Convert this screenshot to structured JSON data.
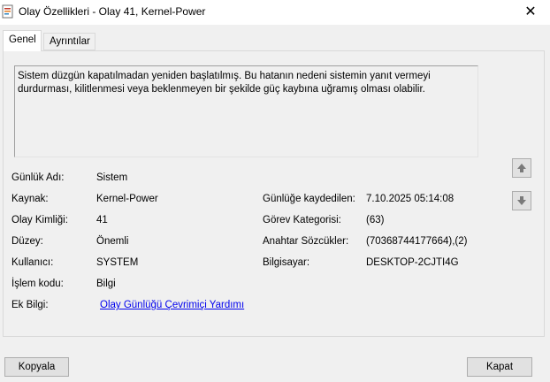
{
  "window": {
    "title": "Olay Özellikleri - Olay 41, Kernel-Power",
    "icon": "event-viewer-icon",
    "close_glyph": "✕"
  },
  "tabs": [
    {
      "label": "Genel",
      "active": true
    },
    {
      "label": "Ayrıntılar",
      "active": false
    }
  ],
  "description": "Sistem düzgün kapatılmadan yeniden başlatılmış. Bu hatanın nedeni sistemin yanıt vermeyi durdurması, kilitlenmesi veya beklenmeyen bir şekilde güç kaybına uğramış olması olabilir.",
  "fields_left": [
    {
      "label": "Günlük Adı:",
      "value": "Sistem"
    },
    {
      "label": "Kaynak:",
      "value": "Kernel-Power"
    },
    {
      "label": "Olay Kimliği:",
      "value": "41"
    },
    {
      "label": "Düzey:",
      "value": "Önemli"
    },
    {
      "label": "Kullanıcı:",
      "value": "SYSTEM"
    },
    {
      "label": "İşlem kodu:",
      "value": "Bilgi"
    },
    {
      "label": "Ek Bilgi:",
      "value": "Olay Günlüğü Çevrimiçi Yardımı"
    }
  ],
  "fields_right": [
    {
      "label": "Günlüğe kaydedilen:",
      "value": "7.10.2025 05:14:08"
    },
    {
      "label": "Görev Kategorisi:",
      "value": "(63)"
    },
    {
      "label": "Anahtar Sözcükler:",
      "value": "(70368744177664),(2)"
    },
    {
      "label": "Bilgisayar:",
      "value": "DESKTOP-2CJTI4G"
    }
  ],
  "buttons": {
    "copy": "Kopyala",
    "close": "Kapat"
  },
  "colors": {
    "link": "#0000ee",
    "arrow": "#7a7a7a"
  }
}
